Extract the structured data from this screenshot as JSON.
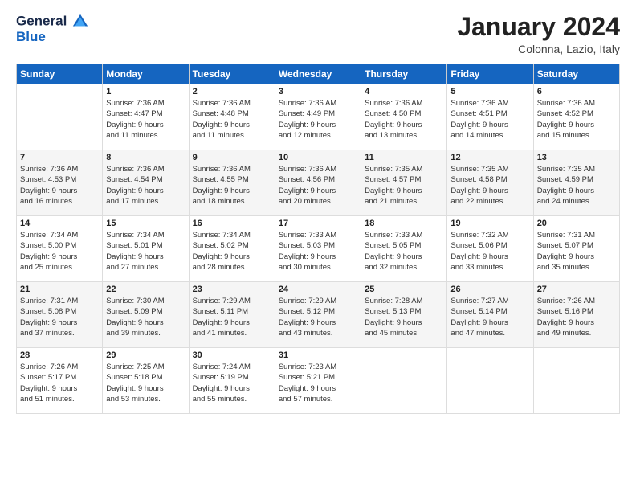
{
  "header": {
    "logo_line1": "General",
    "logo_line2": "Blue",
    "month_title": "January 2024",
    "location": "Colonna, Lazio, Italy"
  },
  "weekdays": [
    "Sunday",
    "Monday",
    "Tuesday",
    "Wednesday",
    "Thursday",
    "Friday",
    "Saturday"
  ],
  "weeks": [
    [
      {
        "day": "",
        "sunrise": "",
        "sunset": "",
        "daylight": ""
      },
      {
        "day": "1",
        "sunrise": "Sunrise: 7:36 AM",
        "sunset": "Sunset: 4:47 PM",
        "daylight": "Daylight: 9 hours and 11 minutes."
      },
      {
        "day": "2",
        "sunrise": "Sunrise: 7:36 AM",
        "sunset": "Sunset: 4:48 PM",
        "daylight": "Daylight: 9 hours and 11 minutes."
      },
      {
        "day": "3",
        "sunrise": "Sunrise: 7:36 AM",
        "sunset": "Sunset: 4:49 PM",
        "daylight": "Daylight: 9 hours and 12 minutes."
      },
      {
        "day": "4",
        "sunrise": "Sunrise: 7:36 AM",
        "sunset": "Sunset: 4:50 PM",
        "daylight": "Daylight: 9 hours and 13 minutes."
      },
      {
        "day": "5",
        "sunrise": "Sunrise: 7:36 AM",
        "sunset": "Sunset: 4:51 PM",
        "daylight": "Daylight: 9 hours and 14 minutes."
      },
      {
        "day": "6",
        "sunrise": "Sunrise: 7:36 AM",
        "sunset": "Sunset: 4:52 PM",
        "daylight": "Daylight: 9 hours and 15 minutes."
      }
    ],
    [
      {
        "day": "7",
        "sunrise": "Sunrise: 7:36 AM",
        "sunset": "Sunset: 4:53 PM",
        "daylight": "Daylight: 9 hours and 16 minutes."
      },
      {
        "day": "8",
        "sunrise": "Sunrise: 7:36 AM",
        "sunset": "Sunset: 4:54 PM",
        "daylight": "Daylight: 9 hours and 17 minutes."
      },
      {
        "day": "9",
        "sunrise": "Sunrise: 7:36 AM",
        "sunset": "Sunset: 4:55 PM",
        "daylight": "Daylight: 9 hours and 18 minutes."
      },
      {
        "day": "10",
        "sunrise": "Sunrise: 7:36 AM",
        "sunset": "Sunset: 4:56 PM",
        "daylight": "Daylight: 9 hours and 20 minutes."
      },
      {
        "day": "11",
        "sunrise": "Sunrise: 7:35 AM",
        "sunset": "Sunset: 4:57 PM",
        "daylight": "Daylight: 9 hours and 21 minutes."
      },
      {
        "day": "12",
        "sunrise": "Sunrise: 7:35 AM",
        "sunset": "Sunset: 4:58 PM",
        "daylight": "Daylight: 9 hours and 22 minutes."
      },
      {
        "day": "13",
        "sunrise": "Sunrise: 7:35 AM",
        "sunset": "Sunset: 4:59 PM",
        "daylight": "Daylight: 9 hours and 24 minutes."
      }
    ],
    [
      {
        "day": "14",
        "sunrise": "Sunrise: 7:34 AM",
        "sunset": "Sunset: 5:00 PM",
        "daylight": "Daylight: 9 hours and 25 minutes."
      },
      {
        "day": "15",
        "sunrise": "Sunrise: 7:34 AM",
        "sunset": "Sunset: 5:01 PM",
        "daylight": "Daylight: 9 hours and 27 minutes."
      },
      {
        "day": "16",
        "sunrise": "Sunrise: 7:34 AM",
        "sunset": "Sunset: 5:02 PM",
        "daylight": "Daylight: 9 hours and 28 minutes."
      },
      {
        "day": "17",
        "sunrise": "Sunrise: 7:33 AM",
        "sunset": "Sunset: 5:03 PM",
        "daylight": "Daylight: 9 hours and 30 minutes."
      },
      {
        "day": "18",
        "sunrise": "Sunrise: 7:33 AM",
        "sunset": "Sunset: 5:05 PM",
        "daylight": "Daylight: 9 hours and 32 minutes."
      },
      {
        "day": "19",
        "sunrise": "Sunrise: 7:32 AM",
        "sunset": "Sunset: 5:06 PM",
        "daylight": "Daylight: 9 hours and 33 minutes."
      },
      {
        "day": "20",
        "sunrise": "Sunrise: 7:31 AM",
        "sunset": "Sunset: 5:07 PM",
        "daylight": "Daylight: 9 hours and 35 minutes."
      }
    ],
    [
      {
        "day": "21",
        "sunrise": "Sunrise: 7:31 AM",
        "sunset": "Sunset: 5:08 PM",
        "daylight": "Daylight: 9 hours and 37 minutes."
      },
      {
        "day": "22",
        "sunrise": "Sunrise: 7:30 AM",
        "sunset": "Sunset: 5:09 PM",
        "daylight": "Daylight: 9 hours and 39 minutes."
      },
      {
        "day": "23",
        "sunrise": "Sunrise: 7:29 AM",
        "sunset": "Sunset: 5:11 PM",
        "daylight": "Daylight: 9 hours and 41 minutes."
      },
      {
        "day": "24",
        "sunrise": "Sunrise: 7:29 AM",
        "sunset": "Sunset: 5:12 PM",
        "daylight": "Daylight: 9 hours and 43 minutes."
      },
      {
        "day": "25",
        "sunrise": "Sunrise: 7:28 AM",
        "sunset": "Sunset: 5:13 PM",
        "daylight": "Daylight: 9 hours and 45 minutes."
      },
      {
        "day": "26",
        "sunrise": "Sunrise: 7:27 AM",
        "sunset": "Sunset: 5:14 PM",
        "daylight": "Daylight: 9 hours and 47 minutes."
      },
      {
        "day": "27",
        "sunrise": "Sunrise: 7:26 AM",
        "sunset": "Sunset: 5:16 PM",
        "daylight": "Daylight: 9 hours and 49 minutes."
      }
    ],
    [
      {
        "day": "28",
        "sunrise": "Sunrise: 7:26 AM",
        "sunset": "Sunset: 5:17 PM",
        "daylight": "Daylight: 9 hours and 51 minutes."
      },
      {
        "day": "29",
        "sunrise": "Sunrise: 7:25 AM",
        "sunset": "Sunset: 5:18 PM",
        "daylight": "Daylight: 9 hours and 53 minutes."
      },
      {
        "day": "30",
        "sunrise": "Sunrise: 7:24 AM",
        "sunset": "Sunset: 5:19 PM",
        "daylight": "Daylight: 9 hours and 55 minutes."
      },
      {
        "day": "31",
        "sunrise": "Sunrise: 7:23 AM",
        "sunset": "Sunset: 5:21 PM",
        "daylight": "Daylight: 9 hours and 57 minutes."
      },
      {
        "day": "",
        "sunrise": "",
        "sunset": "",
        "daylight": ""
      },
      {
        "day": "",
        "sunrise": "",
        "sunset": "",
        "daylight": ""
      },
      {
        "day": "",
        "sunrise": "",
        "sunset": "",
        "daylight": ""
      }
    ]
  ]
}
